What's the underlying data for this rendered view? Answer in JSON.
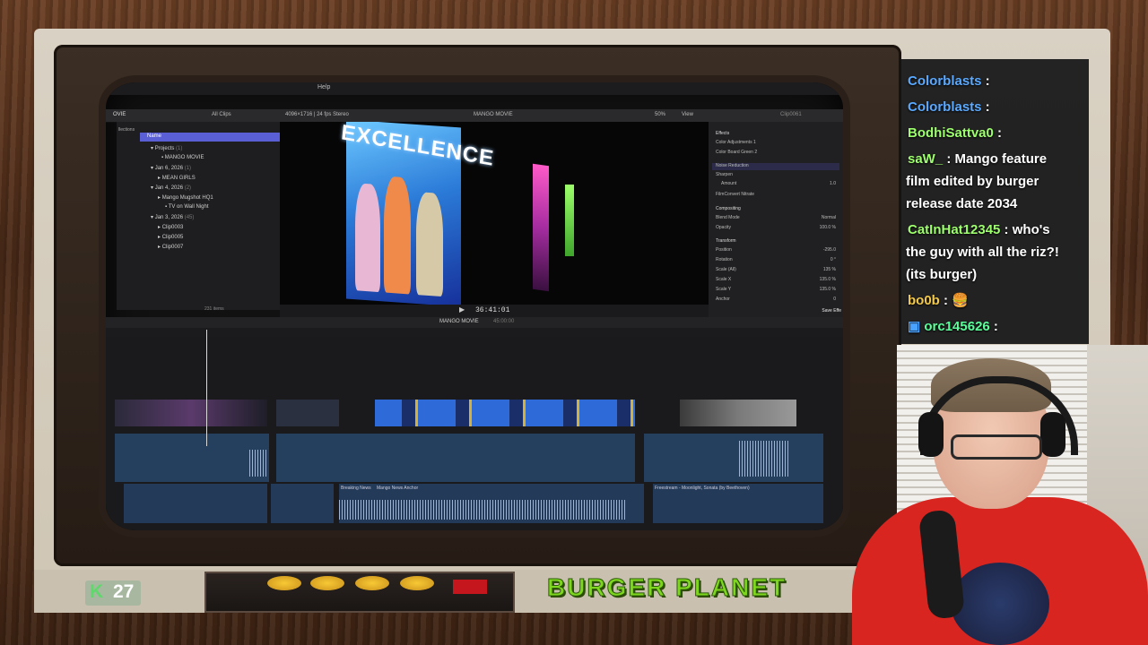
{
  "app": {
    "menubar_text": "Help",
    "toolbar": {
      "browser_filter": "All Clips",
      "clip_info": "4096×1716 | 24 fps Stereo",
      "project_name": "MANGO MOVIE",
      "zoom": "50%",
      "view": "View",
      "inspector_clip": "Clip0061"
    },
    "sidebar_fragments": [
      "OVIE",
      "llections"
    ],
    "browser": {
      "header": "Name",
      "rows": [
        {
          "label": "Projects",
          "count": "(1)",
          "level": 0
        },
        {
          "label": "MANGO MOVIE",
          "count": "",
          "level": 2
        },
        {
          "label": "Jan 6, 2026",
          "count": "(1)",
          "level": 0
        },
        {
          "label": "MEAN GIRLS",
          "count": "",
          "level": 1
        },
        {
          "label": "Jan 4, 2026",
          "count": "(2)",
          "level": 0
        },
        {
          "label": "Mango Mugshot HQ1",
          "count": "",
          "level": 1
        },
        {
          "label": "TV on Wall Night",
          "count": "",
          "level": 2
        },
        {
          "label": "Jan 3, 2026",
          "count": "(45)",
          "level": 0
        },
        {
          "label": "Clip0003",
          "count": "",
          "level": 1
        },
        {
          "label": "Clip0005",
          "count": "",
          "level": 1
        },
        {
          "label": "Clip0007",
          "count": "",
          "level": 1
        }
      ],
      "items_count": "231 items"
    },
    "viewer": {
      "billboard_text": "EXCELLENCE",
      "timecode": "36:41:01"
    },
    "inspector": {
      "effects_title": "Effects",
      "effects": [
        "Color Adjustments 1",
        "Color Board Green 2",
        "Noise Reduction",
        "Sharpen"
      ],
      "amount_label": "Amount",
      "amount_value": "1.0",
      "film_convert": "FilmConvert Nitrate",
      "compositing_title": "Compositing",
      "blend_mode_label": "Blend Mode",
      "blend_mode_value": "Normal",
      "opacity_label": "Opacity",
      "opacity_value": "100.0 %",
      "transform_title": "Transform",
      "position_label": "Position",
      "position_value": "-295.0",
      "rotation_label": "Rotation",
      "rotation_value": "0 °",
      "scale_all_label": "Scale (All)",
      "scale_all_value": "135 %",
      "scale_x_label": "Scale X",
      "scale_x_value": "135.0 %",
      "scale_y_label": "Scale Y",
      "scale_y_value": "135.0 %",
      "anchor_label": "Anchor",
      "anchor_value": "0",
      "save_button": "Save Effe"
    },
    "timeline": {
      "project_name": "MANGO MOVIE",
      "duration": "45:00:00",
      "audio_labels": [
        "Breaking News",
        "Mango News Anchor",
        "Freestream - Moonlight, Sonata (by Beethoven)"
      ]
    }
  },
  "chat": {
    "messages": [
      {
        "user": "Colorblasts",
        "text": "",
        "user_color": "#5aa9ff"
      },
      {
        "user": "Colorblasts",
        "text": "",
        "user_color": "#5aa9ff"
      },
      {
        "user": "BodhiSattva0",
        "text": "",
        "user_color": "#9eff6e"
      },
      {
        "user": "saW_",
        "text": "Mango feature",
        "user_color": "#9eff6e"
      },
      {
        "user": "",
        "text": "film edited by burger",
        "user_color": "#ffffff"
      },
      {
        "user": "",
        "text": "release date 2034",
        "user_color": "#ffffff"
      },
      {
        "user": "CatInHat12345",
        "text": "who's",
        "user_color": "#9eff6e"
      },
      {
        "user": "",
        "text": "the guy with all the riz?!",
        "user_color": "#ffffff"
      },
      {
        "user": "",
        "text": "(its burger)",
        "user_color": "#ffffff"
      },
      {
        "user": "bo0b",
        "text": "",
        "user_color": "#f2c94c"
      },
      {
        "user": "orc145626",
        "text": "",
        "user_color": "#5aff9a"
      }
    ]
  },
  "overlay": {
    "k_icon": "K",
    "k_count": "27",
    "title": "BURGER PLANET",
    "accent_green": "#7ed61e"
  }
}
